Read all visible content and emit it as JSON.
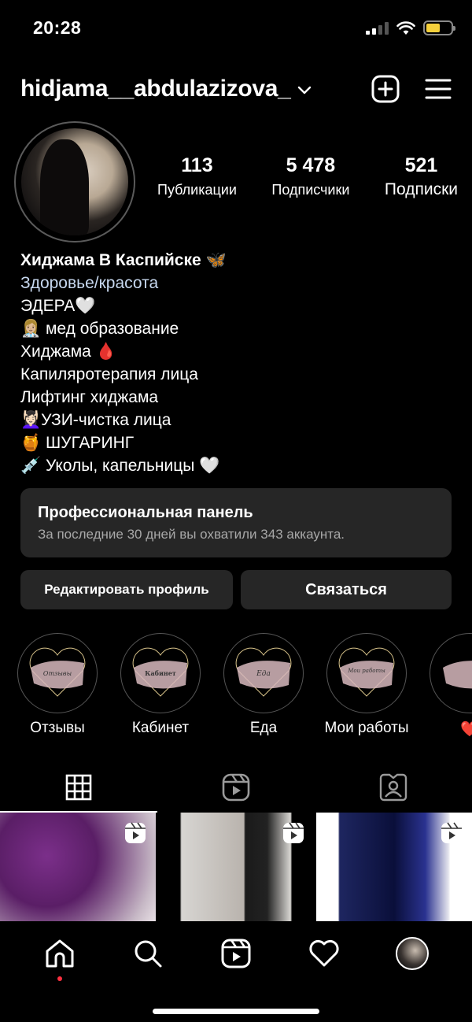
{
  "status_bar": {
    "time": "20:28"
  },
  "header": {
    "username": "hidjama__abdulazizova_"
  },
  "stats": [
    {
      "num": "113",
      "label": "Публикации"
    },
    {
      "num": "5 478",
      "label": "Подписчики"
    },
    {
      "num": "521",
      "label": "Подписки"
    }
  ],
  "bio": {
    "name": "Хиджама В Каспийске 🦋",
    "category": "Здоровье/красота",
    "lines": [
      "ЭДЕРА🤍",
      "👩🏼‍⚕️ мед образование",
      "Хиджама 🩸",
      "Капиляротерапия лица",
      "Лифтинг хиджама",
      "💆🏻‍♀️УЗИ-чистка лица",
      "🍯 ШУГАРИНГ",
      "💉 Уколы, капельницы 🤍"
    ]
  },
  "pro_panel": {
    "title": "Профессиональная панель",
    "subtitle": "За последние 30 дней вы охватили 343 аккаунта."
  },
  "buttons": {
    "edit": "Редактировать профиль",
    "contact": "Связаться"
  },
  "highlights": [
    {
      "label": "Отзывы",
      "cover_text": "Отзывы"
    },
    {
      "label": "Кабинет",
      "cover_text": "Кабинет"
    },
    {
      "label": "Еда",
      "cover_text": "Еда"
    },
    {
      "label": "Мои работы",
      "cover_text": "Мои работы"
    },
    {
      "label": "❤️",
      "cover_text": ""
    }
  ],
  "colors": {
    "accent_red": "#ff3040",
    "panel": "#262626",
    "category": "#c7d8ef",
    "battery": "#f5d03b"
  }
}
